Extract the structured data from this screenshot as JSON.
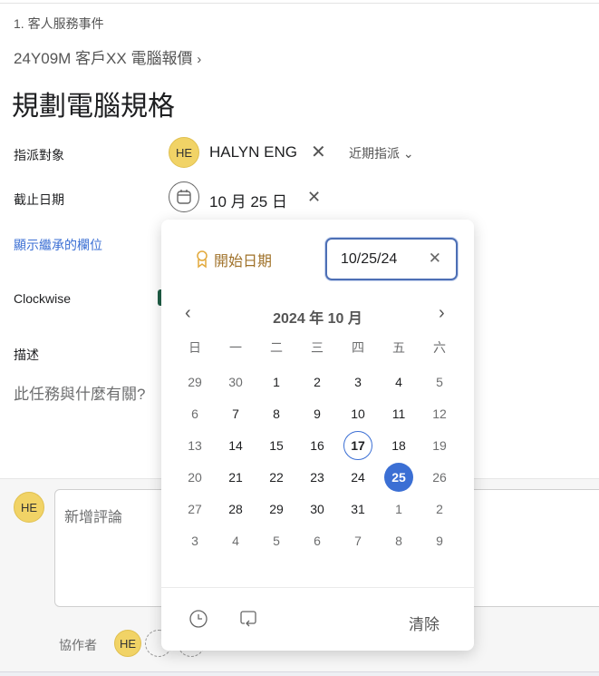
{
  "breadcrumb": {
    "project": "1. 客人服務事件",
    "parent": "24Y09M 客戶XX 電腦報價"
  },
  "task": {
    "title": "規劃電腦規格"
  },
  "fields": {
    "assignee_label": "指派對象",
    "assignee_initials": "HE",
    "assignee_name": "HALYN ENG",
    "recent_label": "近期指派",
    "due_label": "截止日期",
    "due_value": "10 月 25 日",
    "show_inherited": "顯示繼承的欄位",
    "clockwise_label": "Clockwise",
    "description_label": "描述",
    "description_placeholder": "此任務與什麼有關?"
  },
  "comment": {
    "initials": "HE",
    "placeholder": "新增評論",
    "collaborators_label": "協作者",
    "collaborator_initials": "HE"
  },
  "datepicker": {
    "start_date_label": "開始日期",
    "date_input": "10/25/24",
    "month_label": "2024 年 10 月",
    "weekdays": [
      "日",
      "一",
      "二",
      "三",
      "四",
      "五",
      "六"
    ],
    "weeks": [
      [
        "29",
        "30",
        "1",
        "2",
        "3",
        "4",
        "5"
      ],
      [
        "6",
        "7",
        "8",
        "9",
        "10",
        "11",
        "12"
      ],
      [
        "13",
        "14",
        "15",
        "16",
        "17",
        "18",
        "19"
      ],
      [
        "20",
        "21",
        "22",
        "23",
        "24",
        "25",
        "26"
      ],
      [
        "27",
        "28",
        "29",
        "30",
        "31",
        "1",
        "2"
      ],
      [
        "3",
        "4",
        "5",
        "6",
        "7",
        "8",
        "9"
      ]
    ],
    "today": "17",
    "selected": "25",
    "clear_label": "清除",
    "accent": "#3b6fd4"
  }
}
